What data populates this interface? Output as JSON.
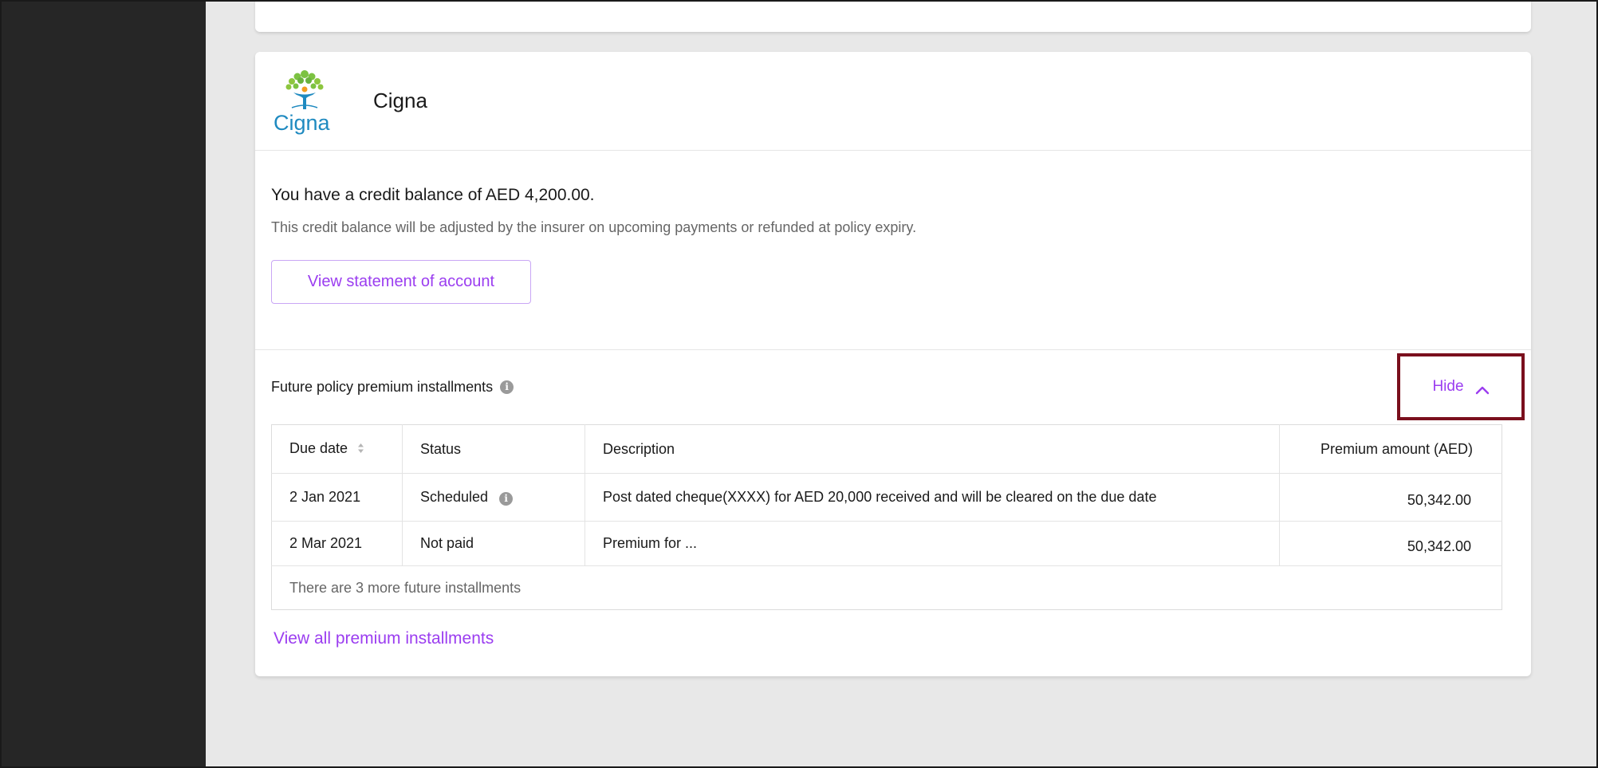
{
  "card": {
    "insurer_name": "Cigna",
    "logo_text": "Cigna",
    "balance_title": "You have a credit balance of AED 4,200.00.",
    "balance_subtitle": "This credit balance will be adjusted by the insurer on upcoming payments or refunded at policy expiry.",
    "statement_button": "View statement of account"
  },
  "future": {
    "title": "Future policy premium installments",
    "hide_label": "Hide",
    "columns": {
      "due_date": "Due date",
      "status": "Status",
      "description": "Description",
      "amount": "Premium amount (AED)"
    },
    "rows": [
      {
        "due_date": "2 Jan 2021",
        "status": "Scheduled",
        "description": "Post dated cheque(XXXX) for AED 20,000 received and will be cleared on the due date",
        "amount": "50,342.00"
      },
      {
        "due_date": "2 Mar 2021",
        "status": "Not paid",
        "description": "Premium for ...",
        "amount": "50,342.00"
      }
    ],
    "more_note": "There are 3 more future installments",
    "view_all_link": "View all premium installments"
  },
  "colors": {
    "accent": "#9b3df0",
    "highlight_border": "#7a0f1d",
    "sidebar": "#262626",
    "background": "#e8e8e8"
  },
  "icons": [
    "cigna-logo-icon",
    "info-icon",
    "chevron-up-icon",
    "sort-icon"
  ]
}
